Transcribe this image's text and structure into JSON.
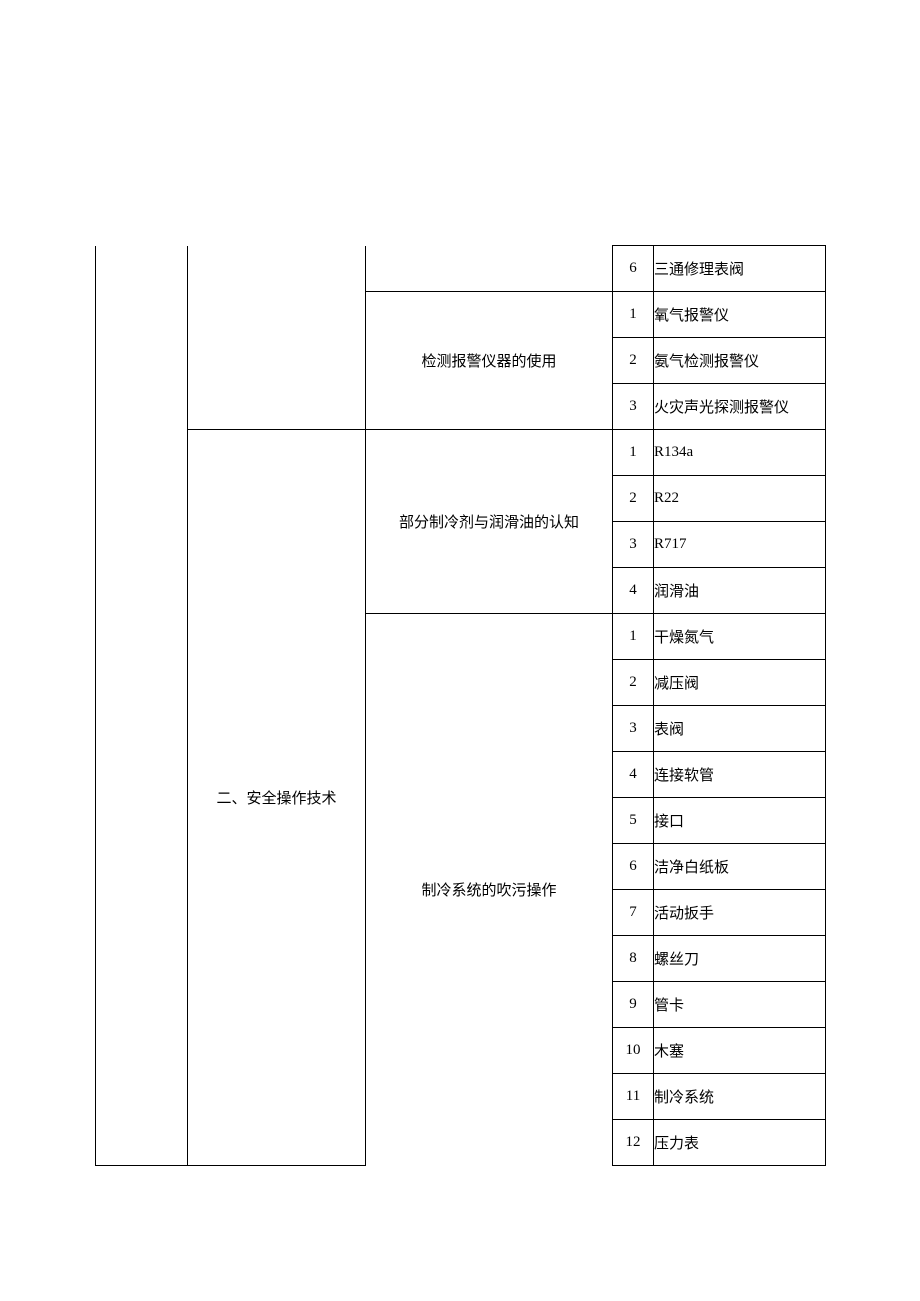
{
  "col_b": "二、安全操作技术",
  "sections": {
    "s0": {
      "title": "",
      "items": [
        {
          "n": "6",
          "t": "三通修理表阀"
        }
      ]
    },
    "s1": {
      "title": "检测报警仪器的使用",
      "items": [
        {
          "n": "1",
          "t": "氧气报警仪"
        },
        {
          "n": "2",
          "t": "氨气检测报警仪"
        },
        {
          "n": "3",
          "t": "火灾声光探测报警仪"
        }
      ]
    },
    "s2": {
      "title": "部分制冷剂与润滑油的认知",
      "items": [
        {
          "n": "1",
          "t": "R134a"
        },
        {
          "n": "2",
          "t": "R22"
        },
        {
          "n": "3",
          "t": "R717"
        },
        {
          "n": "4",
          "t": "润滑油"
        }
      ]
    },
    "s3": {
      "title": "制冷系统的吹污操作",
      "items": [
        {
          "n": "1",
          "t": "干燥氮气"
        },
        {
          "n": "2",
          "t": "减压阀"
        },
        {
          "n": "3",
          "t": "表阀"
        },
        {
          "n": "4",
          "t": "连接软管"
        },
        {
          "n": "5",
          "t": "接口"
        },
        {
          "n": "6",
          "t": "洁净白纸板"
        },
        {
          "n": "7",
          "t": "活动扳手"
        },
        {
          "n": "8",
          "t": "螺丝刀"
        },
        {
          "n": "9",
          "t": "管卡"
        },
        {
          "n": "10",
          "t": "木塞"
        },
        {
          "n": "11",
          "t": "制冷系统"
        },
        {
          "n": "12",
          "t": "压力表"
        }
      ]
    }
  }
}
